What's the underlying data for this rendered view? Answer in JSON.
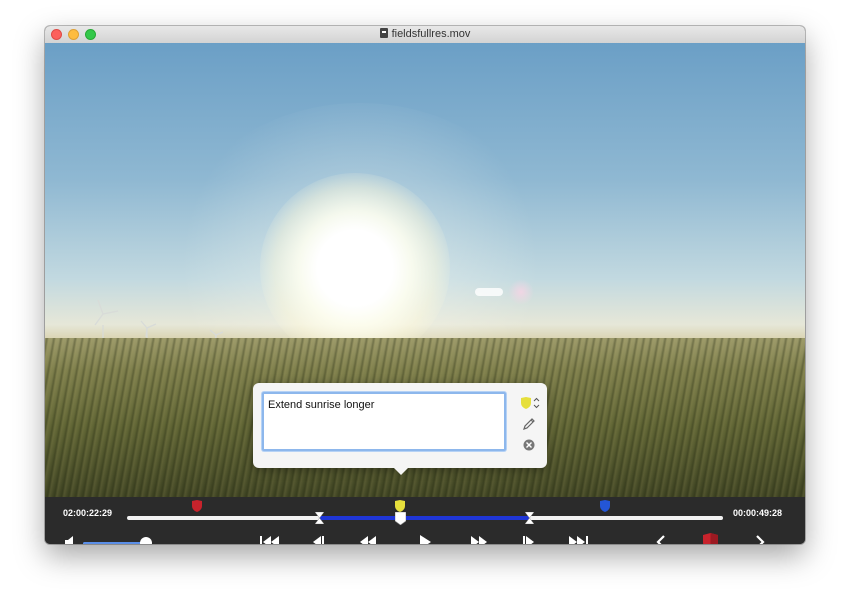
{
  "window": {
    "title": "fieldsfullres.mov"
  },
  "annotation": {
    "note_text": "Extend sunrise longer",
    "color": "#e6df3c"
  },
  "timeline": {
    "current_time": "02:00:22:29",
    "remaining_time": "00:00:49:28",
    "selection_color": "#1f36d6",
    "markers": [
      {
        "color": "#c8232c"
      },
      {
        "color": "#e6df3c"
      },
      {
        "color": "#2456d6"
      }
    ]
  },
  "volume": {
    "level": 0.85
  },
  "transport": {
    "buttons": [
      {
        "name": "skip-to-start-button",
        "icon": "skip-to-start-icon"
      },
      {
        "name": "step-back-button",
        "icon": "step-back-icon"
      },
      {
        "name": "rewind-button",
        "icon": "rewind-icon"
      },
      {
        "name": "play-button",
        "icon": "play-icon"
      },
      {
        "name": "fast-forward-button",
        "icon": "fast-forward-icon"
      },
      {
        "name": "step-forward-button",
        "icon": "step-forward-icon"
      },
      {
        "name": "skip-to-end-button",
        "icon": "skip-to-end-icon"
      }
    ]
  },
  "colors": {
    "accent_blue": "#1f36d6",
    "marker_red": "#c8232c",
    "volume_blue": "#5b8fe8"
  }
}
